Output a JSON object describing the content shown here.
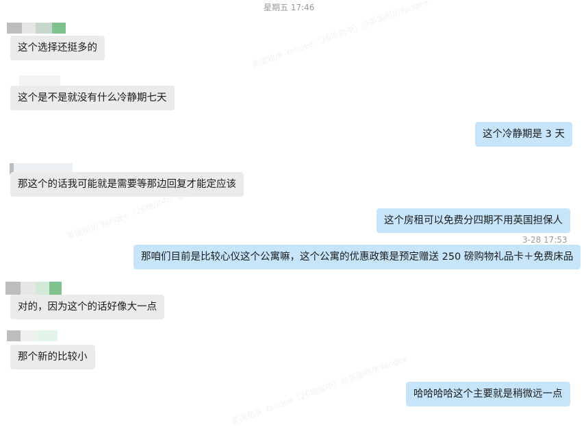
{
  "header": {
    "timestamp": "星期五 17:46"
  },
  "watermark": {
    "text": "英国租房 Yanqee（26地房中）@英国租房Yanqee"
  },
  "messages": [
    {
      "side": "left",
      "text": "这个选择还挺多的"
    },
    {
      "side": "left",
      "text": "这个是不是就没有什么冷静期七天"
    },
    {
      "side": "right",
      "text": "这个冷静期是 3 天"
    },
    {
      "side": "left",
      "text": "那这个的话我可能就是需要等那边回复才能定应该"
    },
    {
      "side": "right",
      "text": "这个房租可以免费分四期不用英国担保人"
    },
    {
      "side": "right",
      "text": "那咱们目前是比较心仪这个公寓嘛，这个公寓的优惠政策是预定赠送 250 磅购物礼品卡＋免费床品"
    },
    {
      "side": "left",
      "text": "对的，因为这个的话好像大一点"
    },
    {
      "side": "left",
      "text": "那个新的比较小"
    },
    {
      "side": "right",
      "text": "哈哈哈哈这个主要就是稍微远一点"
    }
  ],
  "inline_timestamps": [
    "3-28 17:53"
  ],
  "colors": {
    "left_bubble": "#ebebeb",
    "right_bubble": "#c6e5fb",
    "timestamp_text": "#9a9a9a"
  }
}
